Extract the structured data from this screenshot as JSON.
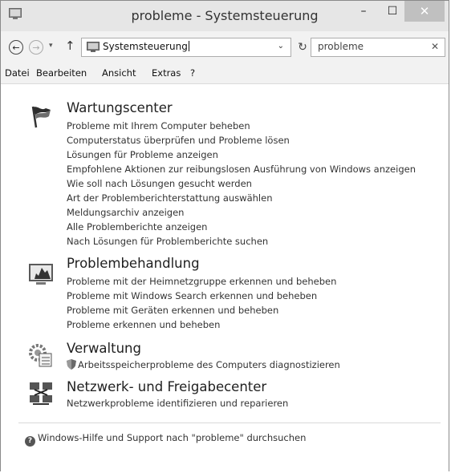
{
  "window": {
    "title": "probleme - Systemsteuerung",
    "minimize": "–",
    "maximize": "☐",
    "close": "✕"
  },
  "nav": {
    "address": "Systemsteuerung",
    "search_value": "probleme",
    "search_clear": "✕",
    "back_icon": "←",
    "forward_icon": "→",
    "recent_icon": "▾",
    "up_icon": "↑",
    "dropdown_icon": "⌄",
    "refresh_icon": "↻"
  },
  "menu": [
    "Datei",
    "Bearbeiten",
    "Ansicht",
    "Extras",
    "?"
  ],
  "categories": [
    {
      "title": "Wartungscenter",
      "icon": "flag-icon",
      "links": [
        "Probleme mit Ihrem Computer beheben",
        "Computerstatus überprüfen und Probleme lösen",
        "Lösungen für Probleme anzeigen",
        "Empfohlene Aktionen zur reibungslosen Ausführung von Windows anzeigen",
        "Wie soll nach Lösungen gesucht werden",
        "Art der Problemberichterstattung auswählen",
        "Meldungsarchiv anzeigen",
        "Alle Problemberichte anzeigen",
        "Nach Lösungen für Problemberichte suchen"
      ]
    },
    {
      "title": "Problembehandlung",
      "icon": "troubleshoot-icon",
      "links": [
        "Probleme mit der Heimnetzgruppe erkennen und beheben",
        "Probleme mit Windows Search erkennen und beheben",
        "Probleme mit Geräten erkennen und beheben",
        "Probleme erkennen und beheben"
      ]
    },
    {
      "title": "Verwaltung",
      "icon": "admin-tools-icon",
      "links": [
        "Arbeitsspeicherprobleme des Computers diagnostizieren"
      ]
    },
    {
      "title": "Netzwerk- und Freigabecenter",
      "icon": "network-icon",
      "links": [
        "Netzwerkprobleme identifizieren und reparieren"
      ]
    }
  ],
  "help": {
    "icon": "?",
    "text": "Windows-Hilfe und Support nach \"probleme\" durchsuchen"
  }
}
